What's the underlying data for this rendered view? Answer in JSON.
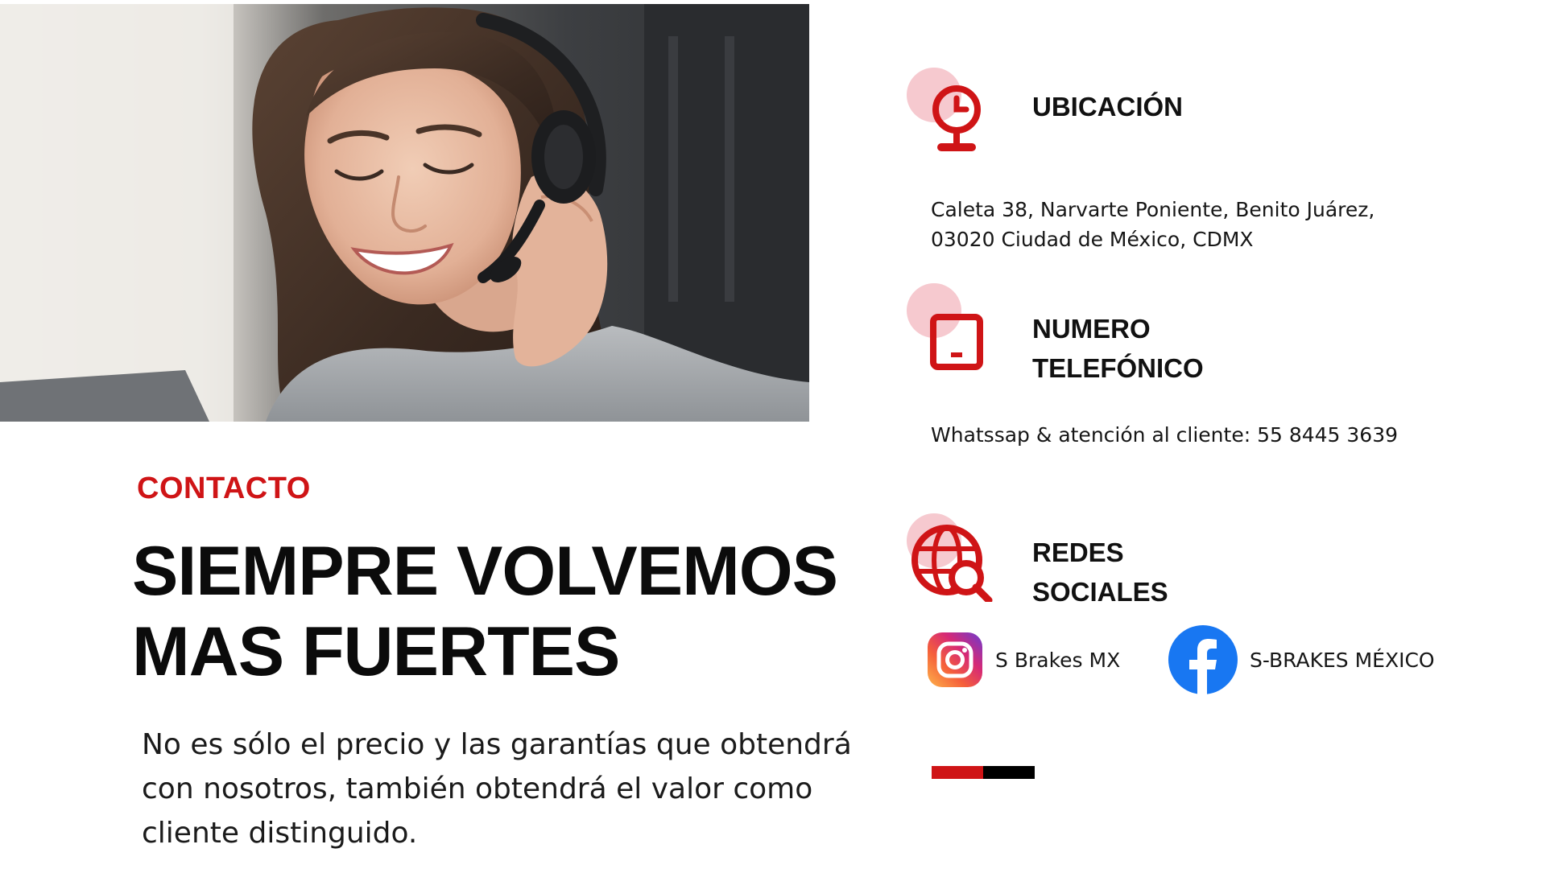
{
  "colors": {
    "accent_red": "#cf1416",
    "accent_pink": "#f6c9cf",
    "black": "#000000",
    "text": "#111111",
    "facebook_blue": "#1877f2"
  },
  "hero": {
    "image": "woman-with-headset-photo"
  },
  "intro": {
    "eyebrow": "CONTACTO",
    "headline_line1": "SIEMPRE VOLVEMOS",
    "headline_line2": "MAS FUERTES",
    "body": "No es sólo el precio y las garantías que obtendrá con nosotros, también obtendrá el valor como cliente distinguido."
  },
  "location": {
    "icon": "location-pin-icon",
    "title": "UBICACIÓN",
    "address_line1": "Caleta 38, Narvarte Poniente, Benito Juárez,",
    "address_line2": "03020 Ciudad de México, CDMX"
  },
  "phone": {
    "icon": "smartphone-icon",
    "title_line1": "NUMERO",
    "title_line2": "TELEFÓNICO",
    "text": "Whatssap & atención al cliente: 55 8445 3639"
  },
  "social": {
    "icon": "globe-search-icon",
    "title_line1": "REDES",
    "title_line2": "SOCIALES",
    "instagram": {
      "icon": "instagram-icon",
      "label": "S Brakes MX"
    },
    "facebook": {
      "icon": "facebook-icon",
      "label": "S-BRAKES MÉXICO"
    }
  }
}
